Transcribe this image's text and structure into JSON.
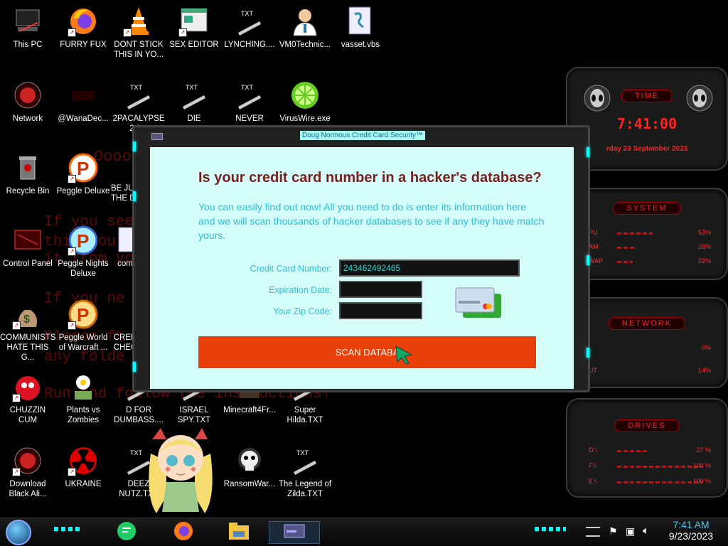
{
  "desktop": {
    "bg_lines": [
      "Oooo",
      "If you see",
      "this you",
      "it from yo",
      "If you ne",
      "Please fi",
      "any folde",
      "Run and follow the instructions!"
    ],
    "icons": [
      {
        "label": "This PC"
      },
      {
        "label": "FURRY FUX"
      },
      {
        "label": "DONT STICK THIS IN YO..."
      },
      {
        "label": "SEX EDITOR"
      },
      {
        "label": "LYNCHING...."
      },
      {
        "label": "VM0Technic..."
      },
      {
        "label": "vasset.vbs"
      },
      {
        "label": "Network"
      },
      {
        "label": "@WanaDec..."
      },
      {
        "label": "2PACALYPSE 2.3..."
      },
      {
        "label": "DIE"
      },
      {
        "label": "NEVER"
      },
      {
        "label": "VirusWire.exe"
      },
      {
        "label": "Recycle Bin"
      },
      {
        "label": "Peggle Deluxe"
      },
      {
        "label": "BE JU THE D"
      },
      {
        "label": "Control Panel"
      },
      {
        "label": "Peggle Nights Deluxe"
      },
      {
        "label": "com"
      },
      {
        "label": "COMMUNISTS HATE THIS G..."
      },
      {
        "label": "Peggle World of Warcraft ..."
      },
      {
        "label": "CRED CHEC"
      },
      {
        "label": "CHUZZIN CUM"
      },
      {
        "label": "Plants vs Zombies"
      },
      {
        "label": "D FOR DUMBASS...."
      },
      {
        "label": "ISRAEL SPY.TXT"
      },
      {
        "label": "Minecraft4Fr..."
      },
      {
        "label": "Super Hilda.TXT"
      },
      {
        "label": "Download Black Ali..."
      },
      {
        "label": "UKRAINE"
      },
      {
        "label": "DEEZ NUTZ.TXT"
      },
      {
        "label": "RansomWar..."
      },
      {
        "label": "The Legend of Zilda.TXT"
      }
    ],
    "txt_badge": "TXT"
  },
  "gadget": {
    "time": {
      "header": "TIME",
      "clock": "7:41:00",
      "date": "rday 23 September 2023"
    },
    "system": {
      "header": "SYSTEM",
      "rows": [
        {
          "label": "PU",
          "value": "53%",
          "level": 0.53
        },
        {
          "label": "AM",
          "value": "26%",
          "level": 0.26
        },
        {
          "label": "WAP",
          "value": "22%",
          "level": 0.22
        }
      ]
    },
    "network": {
      "header": "NETWORK",
      "rows": [
        {
          "label": "",
          "value": "0%",
          "level": 0.0
        },
        {
          "label": "UT",
          "value": "14%",
          "level": 0.14
        }
      ]
    },
    "drives": {
      "header": "DRIVES",
      "rows": [
        {
          "label": "D:\\",
          "value": "27 %",
          "level": 0.27
        },
        {
          "label": "F:\\",
          "value": "100 %",
          "level": 1.0
        },
        {
          "label": "E:\\",
          "value": "100 %",
          "level": 1.0
        }
      ]
    }
  },
  "dialog": {
    "title": "Doug Normous Credit Card Security™",
    "heading": "Is your credit card number in a hacker's database?",
    "description": "You can easily find out now! All you need to do is enter its information here and we will scan thousands of hacker databases to see if any they have match yours.",
    "fields": {
      "card_label": "Credit Card Number:",
      "card_value": "243462492465",
      "exp_label": "Expiration Date:",
      "exp_value": "",
      "zip_label": "Your Zip Code:",
      "zip_value": ""
    },
    "scan_button": "SCAN DATABA"
  },
  "taskbar": {
    "time": "7:41 AM",
    "date": "9/23/2023"
  }
}
